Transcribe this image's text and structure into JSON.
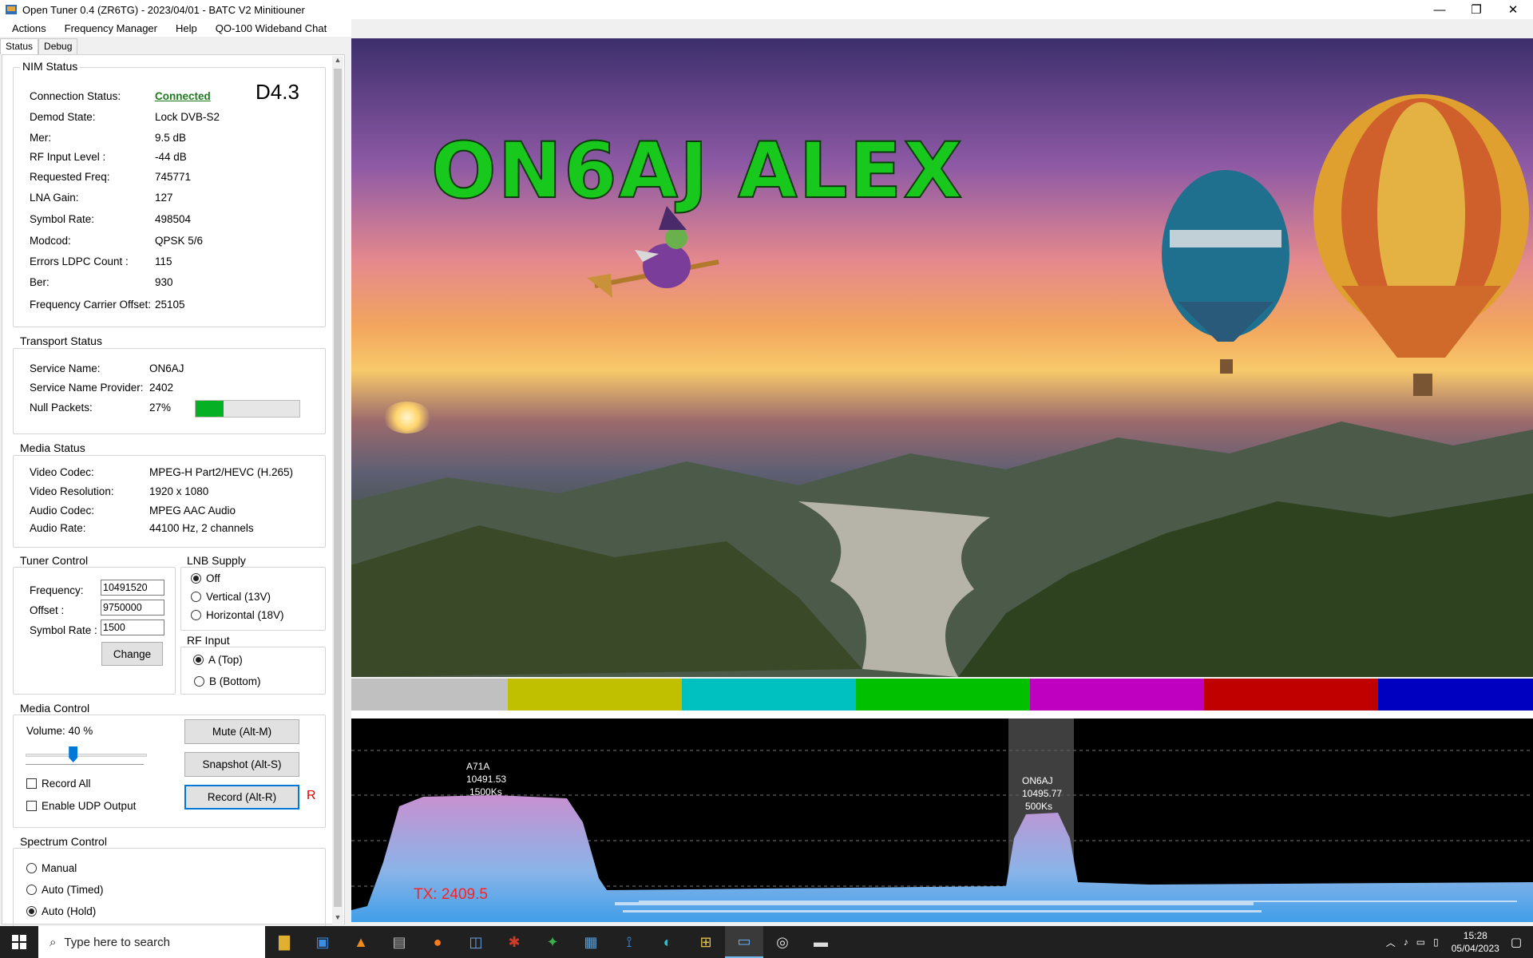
{
  "window": {
    "title": "Open Tuner 0.4 (ZR6TG) - 2023/04/01 - BATC V2 Minitiouner",
    "minimize": "—",
    "maximize": "❐",
    "close": "✕"
  },
  "menu": [
    "Actions",
    "Frequency Manager",
    "Help",
    "QO-100 Wideband Chat"
  ],
  "tabs": [
    "Status",
    "Debug"
  ],
  "nim_status": {
    "title": "NIM Status",
    "badge": "D4.3",
    "rows": [
      {
        "label": "Connection Status:",
        "value": "Connected"
      },
      {
        "label": "Demod State:",
        "value": "Lock DVB-S2"
      },
      {
        "label": "Mer:",
        "value": "9.5 dB"
      },
      {
        "label": "RF Input Level :",
        "value": "-44 dB"
      },
      {
        "label": "Requested Freq:",
        "value": "745771"
      },
      {
        "label": "LNA Gain:",
        "value": "127"
      },
      {
        "label": "Symbol Rate:",
        "value": "498504"
      },
      {
        "label": "Modcod:",
        "value": "QPSK 5/6"
      },
      {
        "label": "Errors LDPC Count :",
        "value": "115"
      },
      {
        "label": "Ber:",
        "value": "930"
      },
      {
        "label": "Frequency Carrier Offset:",
        "value": "25105"
      }
    ]
  },
  "transport_status": {
    "title": "Transport Status",
    "rows": [
      {
        "label": "Service Name:",
        "value": "ON6AJ"
      },
      {
        "label": "Service Name Provider:",
        "value": "2402"
      },
      {
        "label": "Null Packets:",
        "value": "27%"
      }
    ],
    "null_packets_fraction": 0.27
  },
  "media_status": {
    "title": "Media Status",
    "rows": [
      {
        "label": "Video Codec:",
        "value": "MPEG-H Part2/HEVC (H.265)"
      },
      {
        "label": "Video Resolution:",
        "value": "1920 x 1080"
      },
      {
        "label": "Audio Codec:",
        "value": "MPEG AAC Audio"
      },
      {
        "label": "Audio Rate:",
        "value": "44100 Hz, 2 channels"
      }
    ]
  },
  "tuner_control": {
    "title": "Tuner Control",
    "frequency_label": "Frequency:",
    "frequency": "10491520",
    "offset_label": "Offset :",
    "offset": "9750000",
    "symbol_rate_label": "Symbol Rate :",
    "symbol_rate": "1500",
    "change": "Change"
  },
  "lnb_supply": {
    "title": "LNB Supply",
    "options": [
      "Off",
      "Vertical (13V)",
      "Horizontal (18V)"
    ],
    "selected": "Off"
  },
  "rf_input": {
    "title": "RF Input",
    "options": [
      "A (Top)",
      "B (Bottom)"
    ],
    "selected": "A (Top)"
  },
  "media_control": {
    "title": "Media Control",
    "volume_label": "Volume: 40 %",
    "volume_fraction": 0.4,
    "mute": "Mute (Alt-M)",
    "snapshot": "Snapshot (Alt-S)",
    "record": "Record (Alt-R)",
    "record_indicator": "R",
    "record_all": "Record All",
    "enable_udp": "Enable UDP Output"
  },
  "spectrum_control": {
    "title": "Spectrum Control",
    "options": [
      "Manual",
      "Auto (Timed)",
      "Auto (Hold)"
    ],
    "selected": "Auto (Hold)"
  },
  "video": {
    "overlay_text": "ON6AJ  ALEX",
    "bar_colors": [
      "#c0c0c0",
      "#c0c000",
      "#00c0c0",
      "#00c000",
      "#c000c0",
      "#c00000",
      "#0000c0"
    ]
  },
  "spectrum": {
    "signals": [
      {
        "label1": "A71A",
        "label2": "10491.53",
        "label3": "1500Ks"
      },
      {
        "label1": "ON6AJ",
        "label2": "10495.77",
        "label3": "500Ks"
      }
    ],
    "tx_label": "TX: 2409.5"
  },
  "taskbar": {
    "search_placeholder": "Type here to search",
    "time": "15:28",
    "date": "05/04/2023"
  },
  "colors": {
    "accent": "#0078d7",
    "connected": "#1e7b1e",
    "progress": "#06b025",
    "tx": "#ff2020"
  }
}
